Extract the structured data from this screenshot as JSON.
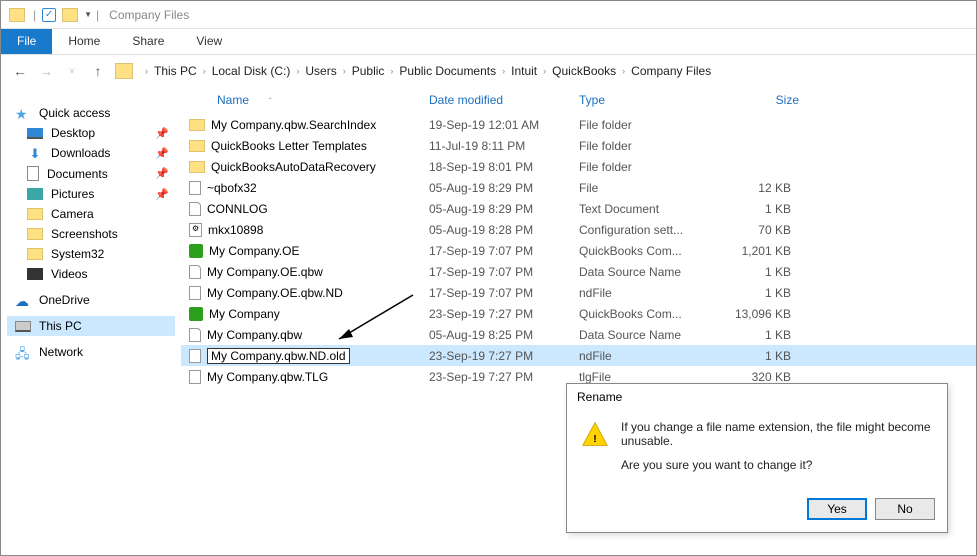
{
  "window": {
    "title": "Company Files"
  },
  "ribbon": {
    "file": "File",
    "home": "Home",
    "share": "Share",
    "view": "View"
  },
  "breadcrumbs": [
    "This PC",
    "Local Disk (C:)",
    "Users",
    "Public",
    "Public Documents",
    "Intuit",
    "QuickBooks",
    "Company Files"
  ],
  "sidebar": {
    "quick": "Quick access",
    "items_quick": [
      {
        "label": "Desktop",
        "pinned": true
      },
      {
        "label": "Downloads",
        "pinned": true
      },
      {
        "label": "Documents",
        "pinned": true
      },
      {
        "label": "Pictures",
        "pinned": true
      },
      {
        "label": "Camera",
        "pinned": false
      },
      {
        "label": "Screenshots",
        "pinned": false
      },
      {
        "label": "System32",
        "pinned": false
      },
      {
        "label": "Videos",
        "pinned": false
      }
    ],
    "onedrive": "OneDrive",
    "thispc": "This PC",
    "network": "Network"
  },
  "columns": {
    "name": "Name",
    "date": "Date modified",
    "type": "Type",
    "size": "Size"
  },
  "files": [
    {
      "icon": "folder",
      "name": "My Company.qbw.SearchIndex",
      "date": "19-Sep-19 12:01 AM",
      "type": "File folder",
      "size": ""
    },
    {
      "icon": "folder",
      "name": "QuickBooks Letter Templates",
      "date": "11-Jul-19 8:11 PM",
      "type": "File folder",
      "size": ""
    },
    {
      "icon": "folder",
      "name": "QuickBooksAutoDataRecovery",
      "date": "18-Sep-19 8:01 PM",
      "type": "File folder",
      "size": ""
    },
    {
      "icon": "file",
      "name": "~qbofx32",
      "date": "05-Aug-19 8:29 PM",
      "type": "File",
      "size": "12 KB"
    },
    {
      "icon": "fileg",
      "name": "CONNLOG",
      "date": "05-Aug-19 8:29 PM",
      "type": "Text Document",
      "size": "1 KB"
    },
    {
      "icon": "cfg",
      "name": "mkx10898",
      "date": "05-Aug-19 8:28 PM",
      "type": "Configuration sett...",
      "size": "70 KB"
    },
    {
      "icon": "qb",
      "name": "My Company.OE",
      "date": "17-Sep-19 7:07 PM",
      "type": "QuickBooks Com...",
      "size": "1,201 KB"
    },
    {
      "icon": "fileg",
      "name": "My Company.OE.qbw",
      "date": "17-Sep-19 7:07 PM",
      "type": "Data Source Name",
      "size": "1 KB"
    },
    {
      "icon": "file",
      "name": "My Company.OE.qbw.ND",
      "date": "17-Sep-19 7:07 PM",
      "type": "ndFile",
      "size": "1 KB"
    },
    {
      "icon": "qb",
      "name": "My Company",
      "date": "23-Sep-19 7:27 PM",
      "type": "QuickBooks Com...",
      "size": "13,096 KB"
    },
    {
      "icon": "fileg",
      "name": "My Company.qbw",
      "date": "05-Aug-19 8:25 PM",
      "type": "Data Source Name",
      "size": "1 KB"
    },
    {
      "icon": "file",
      "name": "My Company.qbw.ND.old",
      "date": "23-Sep-19 7:27 PM",
      "type": "ndFile",
      "size": "1 KB",
      "selected": true,
      "rename": true
    },
    {
      "icon": "file",
      "name": "My Company.qbw.TLG",
      "date": "23-Sep-19 7:27 PM",
      "type": "tlgFile",
      "size": "320 KB"
    }
  ],
  "dialog": {
    "title": "Rename",
    "line1": "If you change a file name extension, the file might become unusable.",
    "line2": "Are you sure you want to change it?",
    "yes": "Yes",
    "no": "No"
  }
}
